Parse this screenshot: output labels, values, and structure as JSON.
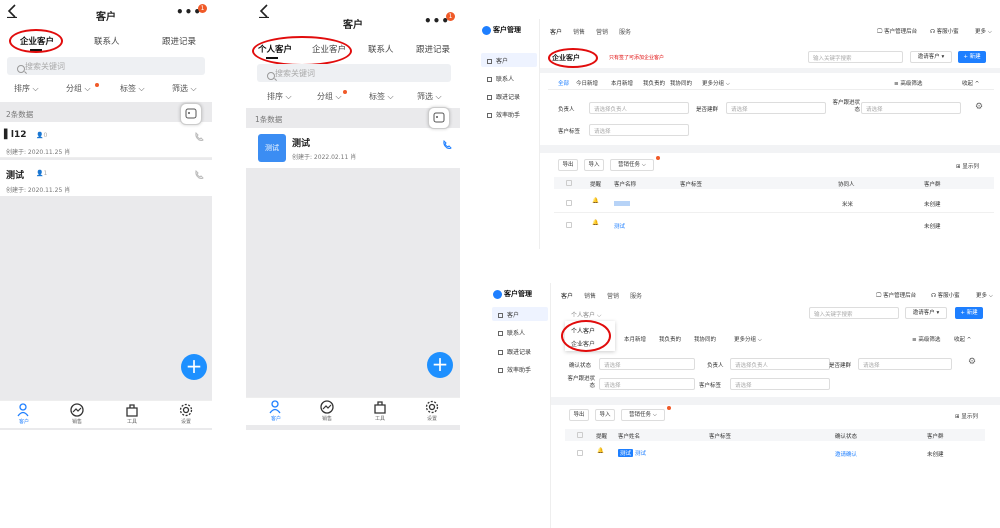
{
  "m1": {
    "title": "客户",
    "badge": "1",
    "tabs": [
      "企业客户",
      "联系人",
      "跟进记录"
    ],
    "search_placeholder": "搜索关键词",
    "filters": [
      "排序",
      "分组",
      "标签",
      "筛选"
    ],
    "count": "2条数据",
    "rows": [
      {
        "name": "l12",
        "meta": "0",
        "created": "创建于: 2020.11.25",
        "owner": "肖"
      },
      {
        "name": "测试",
        "meta": "1",
        "created": "创建于: 2020.11.25",
        "owner": "肖"
      }
    ],
    "nav": [
      "客户",
      "销售",
      "工具",
      "设置"
    ],
    "fab": "+"
  },
  "m2": {
    "title": "客户",
    "badge": "1",
    "tabs": [
      "个人客户",
      "企业客户",
      "联系人",
      "跟进记录"
    ],
    "search_placeholder": "搜索关键词",
    "filters": [
      "排序",
      "分组",
      "标签",
      "筛选"
    ],
    "count": "1条数据",
    "row": {
      "avatar": "测试",
      "name": "测试",
      "created": "创建于: 2022.02.11",
      "owner": "肖"
    },
    "nav": [
      "客户",
      "销售",
      "工具",
      "设置"
    ],
    "fab": "+"
  },
  "w1": {
    "logo": "客户管理",
    "side": [
      "客户",
      "联系人",
      "跟进记录",
      "效率助手"
    ],
    "top_tabs": [
      "客户",
      "销售",
      "营销",
      "服务"
    ],
    "top_right": [
      "客户管理后台",
      "客服小蜜",
      "更多"
    ],
    "tab_label": "企业客户",
    "note": "只有签了可添加企业客户",
    "search_placeholder": "输入关键字搜索",
    "invite": "邀请客户",
    "new": "+ 新建",
    "quick": [
      "全部",
      "今日新增",
      "本月新增",
      "我负责的",
      "我协同的",
      "更多分组"
    ],
    "adv": "高级筛选",
    "collapse": "收起",
    "f_owner": "负责人",
    "f_owner_ph": "请选择负责人",
    "f_linked": "是否建群",
    "f_select": "请选择",
    "f_follow": "客户跟进状态",
    "f_tag": "客户标签",
    "actions": [
      "导出",
      "导入",
      "营销任务"
    ],
    "display": "显示列",
    "headers": [
      "提醒",
      "客户名称",
      "客户标签",
      "协同人",
      "客户群"
    ],
    "rows": [
      {
        "name": "",
        "co": "米米",
        "group": "未创建"
      },
      {
        "name": "测试",
        "co": "",
        "group": "未创建"
      }
    ]
  },
  "w2": {
    "logo": "客户管理",
    "side": [
      "客户",
      "联系人",
      "跟进记录",
      "效率助手"
    ],
    "top_tabs": [
      "客户",
      "销售",
      "营销",
      "服务"
    ],
    "top_right": [
      "客户管理后台",
      "客服小蜜",
      "更多"
    ],
    "tab_label": "个人客户",
    "menu": [
      "个人客户",
      "企业客户"
    ],
    "search_placeholder": "输入关键字搜索",
    "invite": "邀请客户",
    "new": "+ 新建",
    "quick": [
      "本月新增",
      "我负责的",
      "我协同的",
      "更多分组"
    ],
    "adv": "高级筛选",
    "collapse": "收起",
    "f_confirm": "确认状态",
    "f_select": "请选择",
    "f_owner": "负责人",
    "f_owner_ph": "请选择负责人",
    "f_linked": "是否建群",
    "f_follow": "客户跟进状态",
    "f_tag": "客户标签",
    "actions": [
      "导出",
      "导入",
      "营销任务"
    ],
    "display": "显示列",
    "headers": [
      "提醒",
      "客户姓名",
      "客户标签",
      "确认状态",
      "客户群"
    ],
    "row": {
      "tag": "测试",
      "name": "测试",
      "status": "邀请确认",
      "group": "未创建"
    }
  }
}
